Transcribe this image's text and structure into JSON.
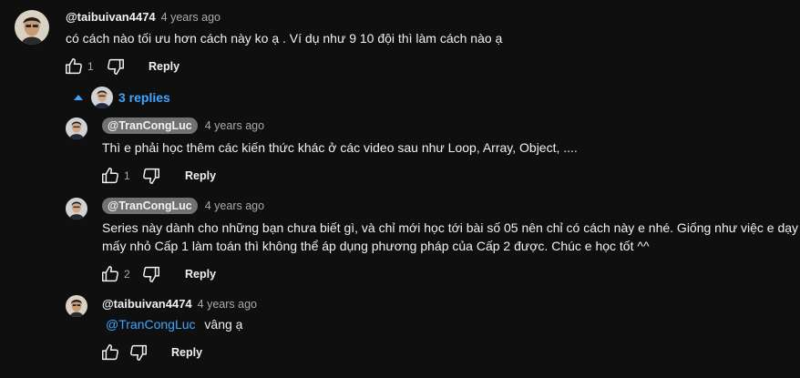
{
  "comment": {
    "author": "@taibuivan4474",
    "time": "4 years ago",
    "text": "có cách nào tối ưu hơn cách này ko ạ . Ví dụ như 9 10 đội thì làm cách nào ạ",
    "likes": "1",
    "reply_label": "Reply"
  },
  "replies_toggle": {
    "label": "3 replies",
    "icon": "chevron-up-icon"
  },
  "replies": [
    {
      "author": "@TranCongLuc",
      "time": "4 years ago",
      "text": "Thì e phải học thêm các kiến thức khác ở các video sau  như Loop, Array, Object, ....",
      "likes": "1",
      "reply_label": "Reply"
    },
    {
      "author": "@TranCongLuc",
      "time": "4 years ago",
      "text_line1": "Series này dành cho những bạn chưa biết gì, và chỉ mới học tới bài số 05 nên chỉ có cách này e nhé. Giống như việc e dạy",
      "text_line2": "mấy nhỏ Cấp 1 làm toán thì không thể áp dụng phương pháp của Cấp 2 được. Chúc e học tốt ^^",
      "likes": "2",
      "reply_label": "Reply"
    },
    {
      "author": "@taibuivan4474",
      "time": "4 years ago",
      "mention": "@TranCongLuc",
      "text": "vâng ạ",
      "likes": "",
      "reply_label": "Reply"
    }
  ],
  "colors": {
    "background": "#0f0f0f",
    "link": "#3ea6ff",
    "secondary_text": "#aaaaaa",
    "author_chip": "#717171"
  }
}
